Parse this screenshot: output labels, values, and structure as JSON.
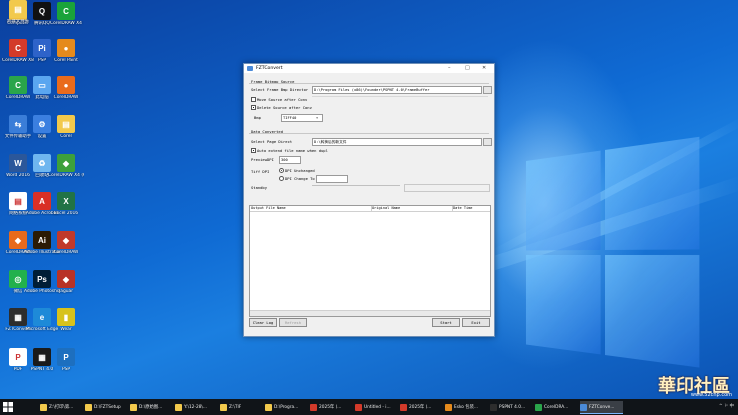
{
  "desktop_icons": [
    {
      "label": "Computer",
      "color": "#f0c040",
      "glyph": "▤"
    },
    {
      "label": "腾讯QQ",
      "color": "#111111",
      "glyph": "Q"
    },
    {
      "label": "CorelDRAW X4",
      "color": "#1aa33a",
      "glyph": "C"
    },
    {
      "label": "CorelDRAW X8",
      "color": "#d33a2a",
      "glyph": "C"
    },
    {
      "label": "PSP",
      "color": "#2e63c9",
      "glyph": "Pi"
    },
    {
      "label": "Corel Paint",
      "color": "#e58a1c",
      "glyph": "●"
    },
    {
      "label": "CorelDRAW",
      "color": "#2aa54b",
      "glyph": "C"
    },
    {
      "label": "此电脑",
      "color": "#5aa6f0",
      "glyph": "▭"
    },
    {
      "label": "CorelDRAW",
      "color": "#e96b1c",
      "glyph": "●"
    },
    {
      "label": "文件传输助手",
      "color": "#3a7dd8",
      "glyph": "⇆"
    },
    {
      "label": "设置",
      "color": "#3b7fe0",
      "glyph": "⚙"
    },
    {
      "label": "Corel",
      "color": "#f2c94c",
      "glyph": "▤"
    },
    {
      "label": "Word 2016",
      "color": "#2b579a",
      "glyph": "W"
    },
    {
      "label": "回收站",
      "color": "#6fb6ef",
      "glyph": "♻"
    },
    {
      "label": "CorelDRAW X4 (64-Bit)",
      "color": "#3da03b",
      "glyph": "◆"
    },
    {
      "label": "网络系统",
      "color": "#ffffff",
      "glyph": "▤"
    },
    {
      "label": "Adobe Acrobat",
      "color": "#d93025",
      "glyph": "A"
    },
    {
      "label": "Excel 2016",
      "color": "#217346",
      "glyph": "X"
    },
    {
      "label": "CorelDRAW",
      "color": "#e86a1c",
      "glyph": "◆"
    },
    {
      "label": "Adobe Illustrator",
      "color": "#2b1b05",
      "glyph": "Ai"
    },
    {
      "label": "CorelDRAW",
      "color": "#c0392b",
      "glyph": "◆"
    },
    {
      "label": "微信",
      "color": "#22b14c",
      "glyph": "◎"
    },
    {
      "label": "Adobe Photoshop",
      "color": "#001e36",
      "glyph": "Ps"
    },
    {
      "label": "Jaguar",
      "color": "#b83226",
      "glyph": "◆"
    },
    {
      "label": "FZTConvert",
      "color": "#2d2d2d",
      "glyph": "▦"
    },
    {
      "label": "Microsoft Edge",
      "color": "#1e8ad8",
      "glyph": "e"
    },
    {
      "label": "Wear",
      "color": "#d7c21c",
      "glyph": "▮"
    },
    {
      "label": "PDF",
      "color": "#ffffff",
      "glyph": "P"
    },
    {
      "label": "PSPNT 4.0",
      "color": "#1a1a1a",
      "glyph": "▦"
    },
    {
      "label": "PSP",
      "color": "#1d6fbf",
      "glyph": "P"
    },
    {
      "label": "新建文件夹",
      "color": "#f2c94c",
      "glyph": "▤"
    }
  ],
  "taskbar": {
    "apps": [
      {
        "label": "Z:\\打印\\第...",
        "color": "#f2c94c"
      },
      {
        "label": "D:\\FZTSetup",
        "color": "#f2c94c"
      },
      {
        "label": "D:\\原始图...",
        "color": "#f2c94c"
      },
      {
        "label": "Y:\\12-28\\...",
        "color": "#f2c94c"
      },
      {
        "label": "Z:\\TIF",
        "color": "#f2c94c"
      },
      {
        "label": "D:\\Progra...",
        "color": "#f2c94c"
      },
      {
        "label": "2025年 (...",
        "color": "#d33a2a"
      },
      {
        "label": "Untitled - i...",
        "color": "#d33a2a"
      },
      {
        "label": "2025年 (...",
        "color": "#d33a2a"
      },
      {
        "label": "Esko 包装...",
        "color": "#e58a1c"
      },
      {
        "label": "PSPNT 4.0...",
        "color": "#2d2d2d"
      },
      {
        "label": "CorelDRA...",
        "color": "#2aa54b"
      },
      {
        "label": "FZTConve...",
        "color": "#4a8ad8"
      }
    ],
    "tray_text": "^ ⚐ 中"
  },
  "watermark": {
    "text": "華印社區",
    "url": "www.52cnp.com"
  },
  "window": {
    "title": "FZTConvert",
    "section_frame": "Frame Bitmap Source",
    "select_frame_label": "Select Frame Bmp Director",
    "frame_path": "D:\\Program Files (x86)\\Founder\\PSPNT 4.0\\FrameBuffer",
    "move_source_label": "Move Source after Conv",
    "move_source_checked": false,
    "delete_source_label": "Delete Source after Conv",
    "delete_source_checked": true,
    "bmp_label": "Bmp",
    "bmp_value": "TIFF40",
    "section_data": "Data Converted",
    "select_page_label": "Select Page Direct",
    "page_path": "D:\\转换后的新文件",
    "auto_extend_label": "Auto extend file name when dupl",
    "auto_extend_checked": true,
    "preview_dpi_label": "PreviewDPI",
    "preview_dpi_value": "300",
    "tiff_dpi_label": "Tiff DPI",
    "dpi_unchanged_label": "DPI Unchanged",
    "dpi_change_label": "DPI Change To",
    "dpi_change_value": "",
    "status_text": "Standby",
    "columns": [
      "Output File Name",
      "Original Name",
      "Date Time"
    ],
    "clear_log_label": "Clear Log",
    "refresh_label": "Refresh",
    "start_label": "Start",
    "exit_label": "Exit"
  }
}
